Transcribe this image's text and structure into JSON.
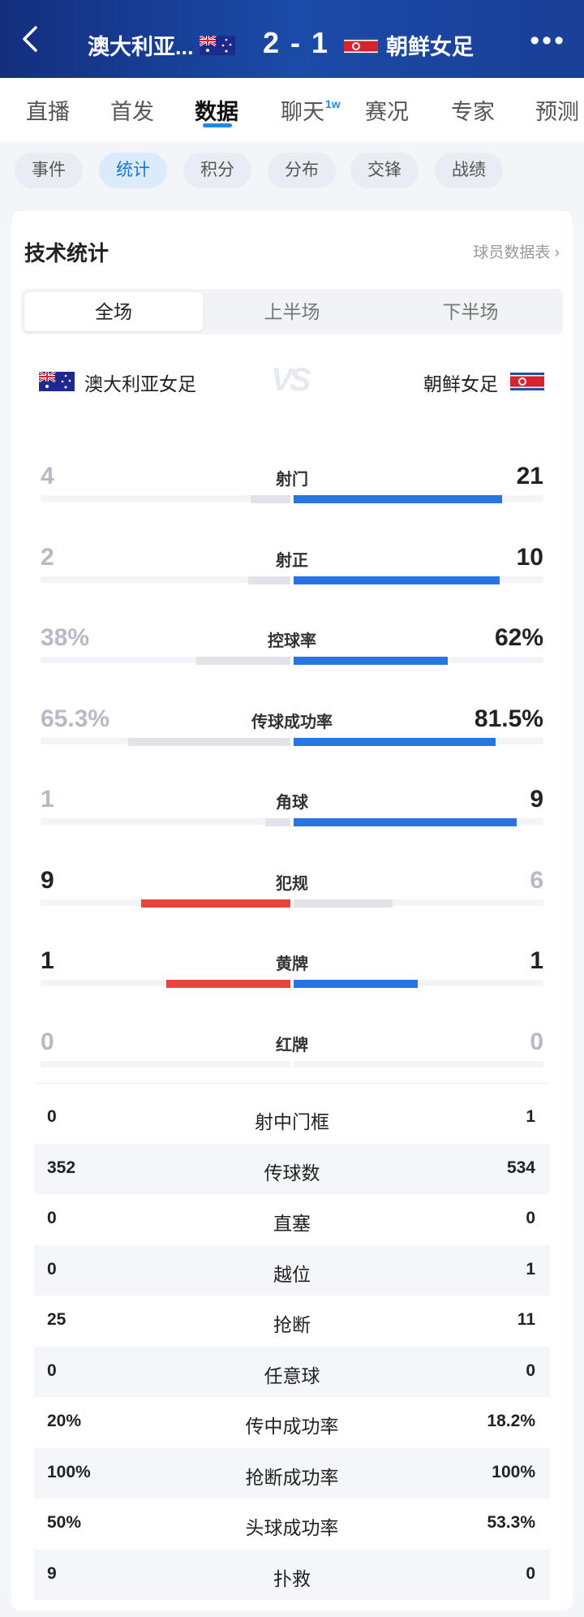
{
  "header": {
    "home_team": "澳大利亚...",
    "score": "2 - 1",
    "away_team": "朝鲜女足",
    "more": "•••"
  },
  "main_tabs": [
    {
      "label": "直播"
    },
    {
      "label": "首发"
    },
    {
      "label": "数据"
    },
    {
      "label": "聊天",
      "badge": "1w"
    },
    {
      "label": "赛况"
    },
    {
      "label": "专家"
    },
    {
      "label": "预测"
    }
  ],
  "sub_tabs": [
    {
      "label": "事件"
    },
    {
      "label": "统计"
    },
    {
      "label": "积分"
    },
    {
      "label": "分布"
    },
    {
      "label": "交锋"
    },
    {
      "label": "战绩"
    }
  ],
  "stats_section": {
    "title": "技术统计",
    "player_link": "球员数据表 ›",
    "segments": [
      "全场",
      "上半场",
      "下半场"
    ],
    "home_team": "澳大利亚女足",
    "away_team": "朝鲜女足",
    "vs": "VS"
  },
  "colors": {
    "blue": "#2a73e3",
    "red": "#e9443b",
    "grey": "#e1e3e8",
    "header_blue": "#1b4aa8"
  },
  "bar_stats": [
    {
      "label": "射门",
      "home": "4",
      "away": "21",
      "home_frac": 0.16,
      "away_frac": 0.84,
      "home_color": "grey",
      "away_color": "blue",
      "winner": "away"
    },
    {
      "label": "射正",
      "home": "2",
      "away": "10",
      "home_frac": 0.17,
      "away_frac": 0.83,
      "home_color": "grey",
      "away_color": "blue",
      "winner": "away"
    },
    {
      "label": "控球率",
      "home": "38%",
      "away": "62%",
      "home_frac": 0.38,
      "away_frac": 0.62,
      "home_color": "grey",
      "away_color": "blue",
      "winner": "away"
    },
    {
      "label": "传球成功率",
      "home": "65.3%",
      "away": "81.5%",
      "home_frac": 0.653,
      "away_frac": 0.815,
      "home_color": "grey",
      "away_color": "blue",
      "winner": "away"
    },
    {
      "label": "角球",
      "home": "1",
      "away": "9",
      "home_frac": 0.1,
      "away_frac": 0.9,
      "home_color": "grey",
      "away_color": "blue",
      "winner": "away"
    },
    {
      "label": "犯规",
      "home": "9",
      "away": "6",
      "home_frac": 0.6,
      "away_frac": 0.4,
      "home_color": "red",
      "away_color": "grey",
      "winner": "home"
    },
    {
      "label": "黄牌",
      "home": "1",
      "away": "1",
      "home_frac": 0.5,
      "away_frac": 0.5,
      "home_color": "red",
      "away_color": "blue",
      "winner": "both"
    },
    {
      "label": "红牌",
      "home": "0",
      "away": "0",
      "home_frac": 0,
      "away_frac": 0,
      "home_color": "grey",
      "away_color": "grey",
      "winner": "none"
    }
  ],
  "table_stats": [
    {
      "label": "射中门框",
      "home": "0",
      "away": "1"
    },
    {
      "label": "传球数",
      "home": "352",
      "away": "534"
    },
    {
      "label": "直塞",
      "home": "0",
      "away": "0"
    },
    {
      "label": "越位",
      "home": "0",
      "away": "1"
    },
    {
      "label": "抢断",
      "home": "25",
      "away": "11"
    },
    {
      "label": "任意球",
      "home": "0",
      "away": "0"
    },
    {
      "label": "传中成功率",
      "home": "20%",
      "away": "18.2%"
    },
    {
      "label": "抢断成功率",
      "home": "100%",
      "away": "100%"
    },
    {
      "label": "头球成功率",
      "home": "50%",
      "away": "53.3%"
    },
    {
      "label": "扑救",
      "home": "9",
      "away": "0"
    }
  ]
}
